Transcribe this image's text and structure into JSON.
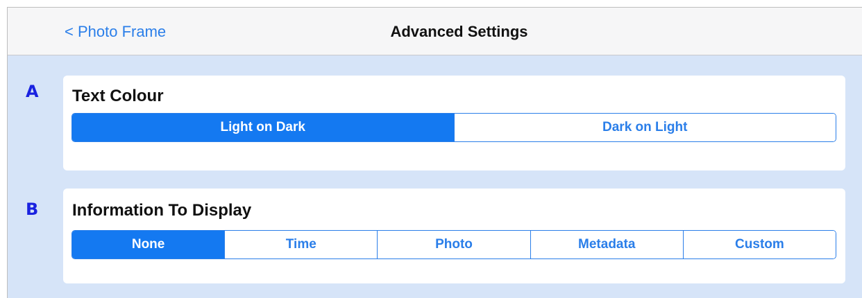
{
  "nav": {
    "back_label": "< Photo Frame",
    "title": "Advanced Settings"
  },
  "sections": [
    {
      "letter": "A",
      "title": "Text Colour",
      "options": [
        "Light on Dark",
        "Dark on Light"
      ],
      "selected": "Light on Dark"
    },
    {
      "letter": "B",
      "title": "Information To Display",
      "options": [
        "None",
        "Time",
        "Photo",
        "Metadata",
        "Custom"
      ],
      "selected": "None"
    }
  ],
  "colors": {
    "accent": "#1479f1",
    "link": "#2a7ee9",
    "background": "#d6e4f8",
    "annotation": "#1a22e0"
  }
}
